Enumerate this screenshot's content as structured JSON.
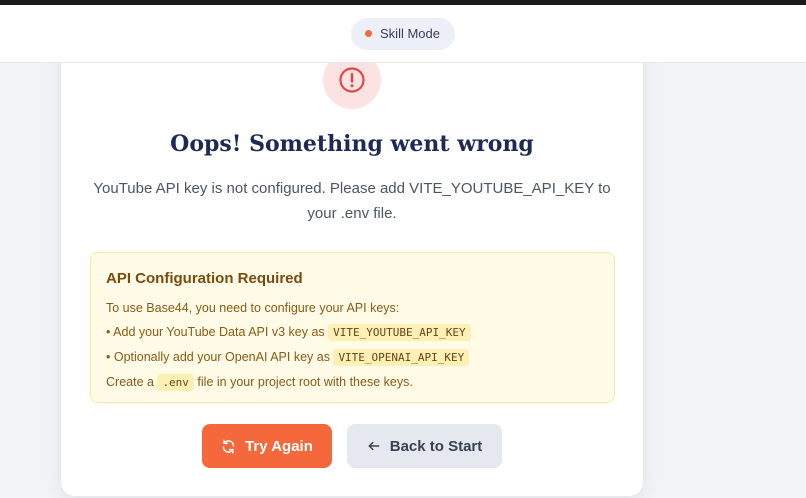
{
  "header": {
    "mode_label": "Skill Mode",
    "mode_dot_color": "#f26b3a"
  },
  "error": {
    "icon": "exclamation-circle-icon",
    "title": "Oops! Something went wrong",
    "message": "YouTube API key is not configured. Please add VITE_YOUTUBE_API_KEY to your .env file."
  },
  "notice": {
    "title": "API Configuration Required",
    "intro": "To use Base44, you need to configure your API keys:",
    "items": [
      {
        "text": "• Add your YouTube Data API v3 key as",
        "code": "VITE_YOUTUBE_API_KEY"
      },
      {
        "text": "• Optionally add your OpenAI API key as",
        "code": "VITE_OPENAI_API_KEY"
      }
    ],
    "footer_pre": "Create a",
    "footer_code": ".env",
    "footer_post": "file in your project root with these keys."
  },
  "actions": {
    "retry_label": "Try Again",
    "retry_icon": "refresh-icon",
    "back_label": "Back to Start",
    "back_icon": "arrow-left-icon"
  },
  "colors": {
    "accent": "#f4683b",
    "title": "#1e2a55",
    "notice_bg": "#fffbe6",
    "notice_text": "#8a5a16",
    "error_circle_bg": "#fde2e2",
    "error_icon": "#e04848"
  }
}
